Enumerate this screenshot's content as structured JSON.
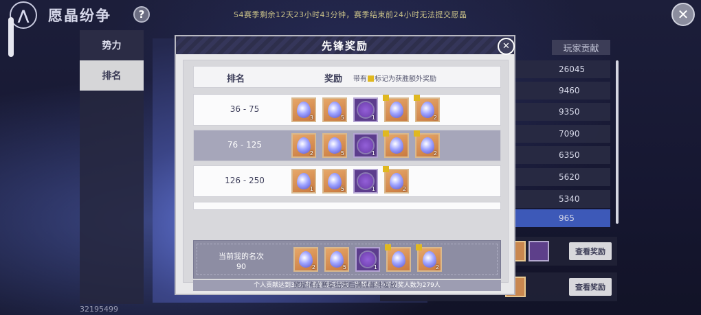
{
  "header": {
    "title": "愿晶纷争",
    "help_label": "?",
    "season_info": "S4赛季剩余12天23小时43分钟，赛季结束前24小时无法提交愿晶",
    "close_label": "✕"
  },
  "sidebar": {
    "items": [
      {
        "label": "势力"
      },
      {
        "label": "排名"
      }
    ],
    "bottom_number": "32195499"
  },
  "background_list": {
    "column_header": "玩家贡献",
    "values": [
      "26045",
      "9460",
      "9350",
      "7090",
      "6350",
      "5620",
      "5340",
      "965"
    ],
    "reward_button_label": "查看奖励"
  },
  "modal": {
    "title": "先锋奖励",
    "close_label": "✕",
    "table_head": {
      "rank": "排名",
      "reward": "奖励",
      "note_prefix": "带有",
      "note_suffix": "标记为获胜额外奖励"
    },
    "rows": [
      {
        "rank": "36 - 75",
        "items": [
          {
            "type": "multi",
            "count": "3",
            "bonus": false
          },
          {
            "type": "drop",
            "count": "5",
            "bonus": false
          },
          {
            "type": "frame",
            "count": "1",
            "bonus": false
          },
          {
            "type": "multi",
            "count": "",
            "bonus": true
          },
          {
            "type": "drop",
            "count": "2",
            "bonus": true
          }
        ]
      },
      {
        "rank": "76 - 125",
        "items": [
          {
            "type": "multi",
            "count": "2",
            "bonus": false
          },
          {
            "type": "drop",
            "count": "5",
            "bonus": false
          },
          {
            "type": "frame",
            "count": "1",
            "bonus": false
          },
          {
            "type": "multi",
            "count": "",
            "bonus": true
          },
          {
            "type": "drop",
            "count": "2",
            "bonus": true
          }
        ]
      },
      {
        "rank": "126 - 250",
        "items": [
          {
            "type": "multi",
            "count": "1",
            "bonus": false
          },
          {
            "type": "drop",
            "count": "5",
            "bonus": false
          },
          {
            "type": "frame",
            "count": "1",
            "bonus": false
          },
          {
            "type": "drop",
            "count": "2",
            "bonus": true
          }
        ]
      }
    ],
    "my_rank": {
      "label_line1": "当前我的名次",
      "label_line2": "90",
      "items": [
        {
          "type": "multi",
          "count": "2",
          "bonus": false
        },
        {
          "type": "drop",
          "count": "5",
          "bonus": false
        },
        {
          "type": "frame",
          "count": "1",
          "bonus": false
        },
        {
          "type": "multi",
          "count": "",
          "bonus": true
        },
        {
          "type": "drop",
          "count": "2",
          "bonus": true
        }
      ]
    },
    "my_rank_note": "个人贡献达到30才有资格领取奖励，当前本势力可领奖人数为279人",
    "footer_note": "奖励将在赛季结束后通过邮件发放"
  },
  "colors": {
    "modal_header": "#2e2f4c",
    "bonus_mark": "#e0b820",
    "highlight_row": "#3d59b8"
  }
}
